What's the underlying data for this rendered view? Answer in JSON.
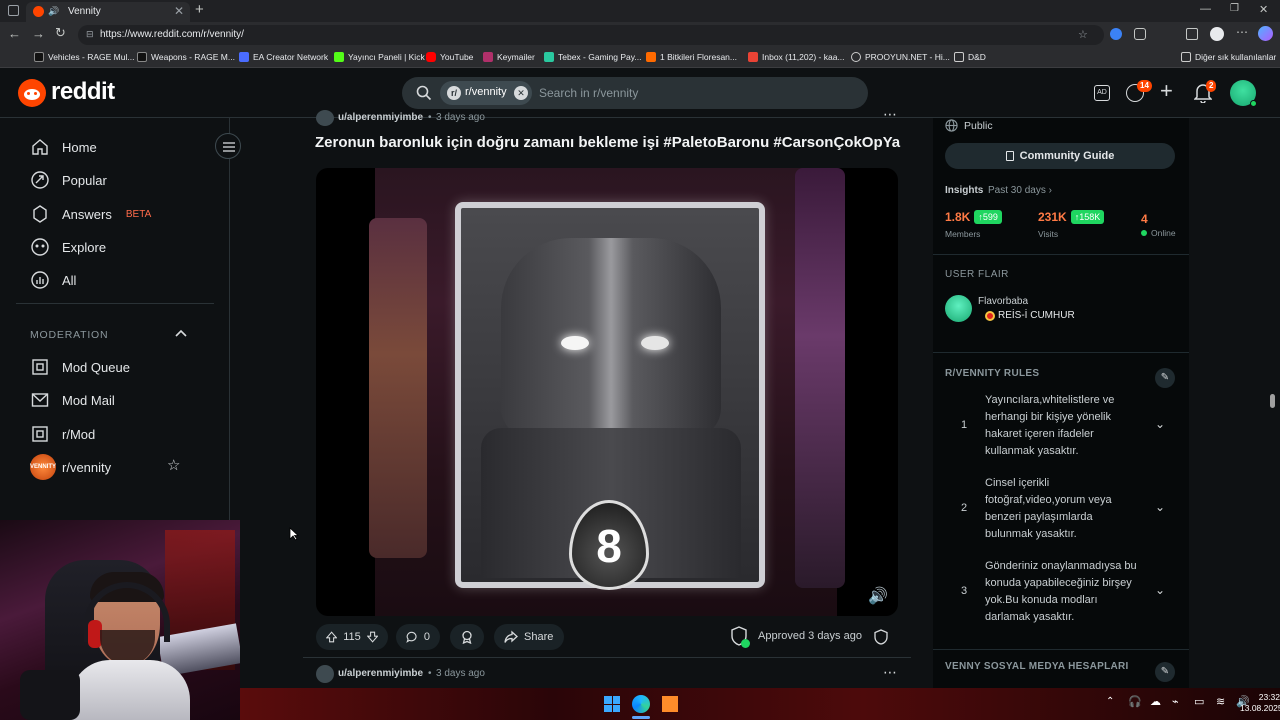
{
  "browser": {
    "tab_title": "Vennity",
    "url": "https://www.reddit.com/r/vennity/",
    "bookmarks": [
      "Vehicles - RAGE Mul...",
      "Weapons - RAGE M...",
      "EA Creator Network",
      "Yayıncı Paneli | Kick",
      "YouTube",
      "Keymailer",
      "Tebex - Gaming Pay...",
      "1 Bitkileri Floresan...",
      "Inbox (11,202) - kaa...",
      "PROOYUN.NET - Hi...",
      "D&D"
    ],
    "other_bookmarks": "Diğer sık kullanılanlar"
  },
  "header": {
    "logo_text": "reddit",
    "subreddit_chip": "r/vennity",
    "search_placeholder": "Search in r/vennity",
    "chat_badge": "14",
    "notif_badge": "2"
  },
  "sidebar": {
    "nav": [
      {
        "label": "Home",
        "icon": "home-icon"
      },
      {
        "label": "Popular",
        "icon": "popular-icon"
      },
      {
        "label": "Answers",
        "icon": "answers-icon",
        "badge": "BETA"
      },
      {
        "label": "Explore",
        "icon": "explore-icon"
      },
      {
        "label": "All",
        "icon": "all-icon"
      }
    ],
    "moderation_title": "MODERATION",
    "mod_items": [
      {
        "label": "Mod Queue",
        "icon": "mod-queue-icon"
      },
      {
        "label": "Mod Mail",
        "icon": "mod-mail-icon"
      },
      {
        "label": "r/Mod",
        "icon": "rmod-icon"
      },
      {
        "label": "r/vennity",
        "icon": "vennity-avatar-icon"
      }
    ]
  },
  "post": {
    "author": "u/alperenmiyimbe",
    "time": "3 days ago",
    "title": "Zeronun baronluk için doğru zamanı bekleme işi #PaletoBaronu #CarsonÇokOpYa",
    "card_number": "8",
    "votes": "115",
    "comments": "0",
    "share_label": "Share",
    "approved_text": "Approved 3 days ago"
  },
  "next_post": {
    "author": "u/alperenmiyimbe",
    "time": "3 days ago"
  },
  "rightcol": {
    "visibility": "Public",
    "community_guide": "Community Guide",
    "insights_label": "Insights",
    "insights_period": "Past 30 days",
    "members_value": "1.8K",
    "members_delta": "599",
    "members_label": "Members",
    "visits_value": "231K",
    "visits_delta": "158K",
    "visits_label": "Visits",
    "online_value": "4",
    "online_label": "Online",
    "user_flair_title": "USER FLAIR",
    "flair_user": "Flavorbaba",
    "flair_text": "REİS-İ CUMHUR",
    "rules_title": "R/VENNITY RULES",
    "rules": [
      {
        "num": "1",
        "text": "Yayıncılara,whitelistlere ve herhangi bir kişiye yönelik hakaret içeren ifadeler kullanmak yasaktır."
      },
      {
        "num": "2",
        "text": "Cinsel içerikli fotoğraf,video,yorum veya benzeri paylaşımlarda bulunmak yasaktır."
      },
      {
        "num": "3",
        "text": "Gönderiniz onaylanmadıysa bu konuda yapabileceğiniz birşey yok.Bu konuda modları darlamak yasaktır."
      }
    ],
    "social_title": "VENNY SOSYAL MEDYA HESAPLARI"
  },
  "taskbar": {
    "time": "23:32",
    "date": "13.08.2025"
  }
}
